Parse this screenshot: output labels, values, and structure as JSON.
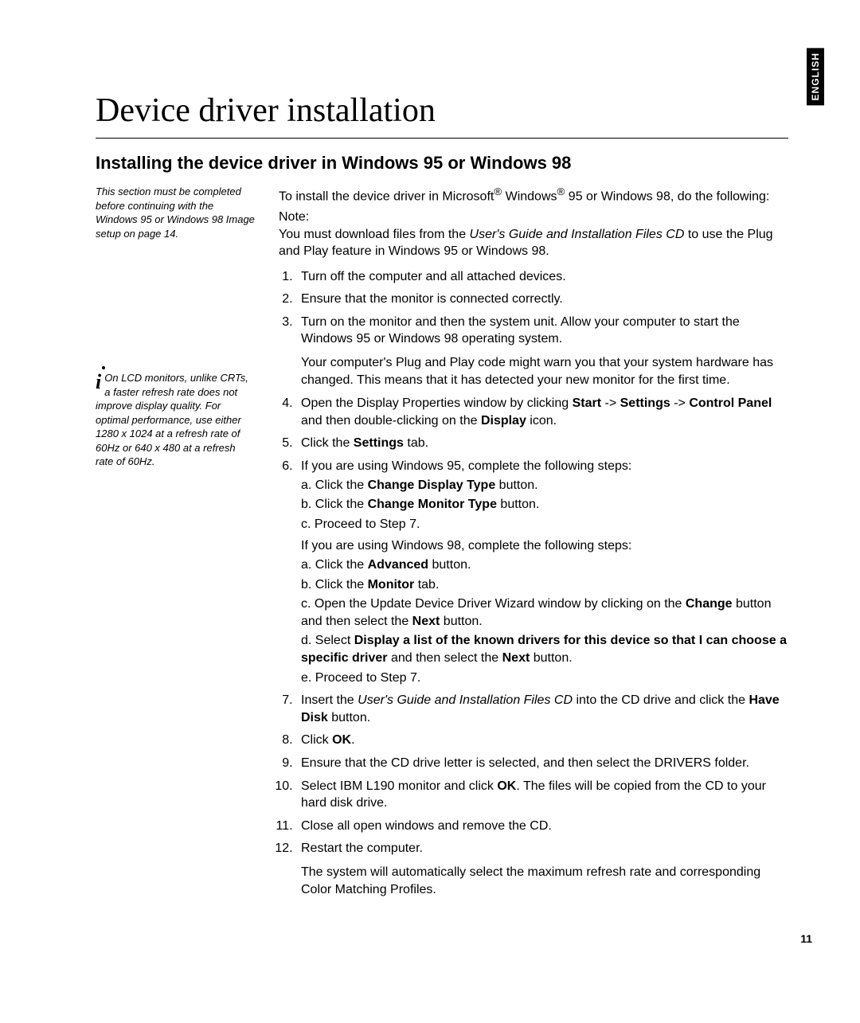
{
  "lang_tab": "ENGLISH",
  "main_title": "Device driver installation",
  "section_title": "Installing the device driver in Windows 95 or Windows 98",
  "sidebar": {
    "note1": "This section must be completed before continuing with the Windows 95 or Windows 98 Image setup on page 14.",
    "note2": "On LCD monitors, unlike CRTs, a faster refresh rate does not improve display quality. For optimal performance, use either 1280 x 1024 at a refresh rate of 60Hz or 640 x 480 at a refresh rate of 60Hz."
  },
  "content": {
    "intro_a": "To install the device driver in Microsoft",
    "reg": "®",
    "intro_b": " Windows",
    "intro_c": " 95 or Windows 98, do the following:",
    "note_label": "Note:",
    "note_body_a": "You must download files from the ",
    "note_body_it": "User's Guide and Installation Files CD",
    "note_body_b": " to use the Plug and Play feature in Windows 95 or Windows 98.",
    "step1": "Turn off the computer and all attached devices.",
    "step2": "Ensure that the monitor is connected correctly.",
    "step3": "Turn on the monitor and then the system unit. Allow your computer to start the Windows 95 or Windows 98 operating system.",
    "step3_p": "Your computer's Plug and Play code might warn you that your system hardware has changed. This means that it has detected your new monitor for the first time.",
    "step4_a": "Open the Display Properties window by clicking ",
    "step4_b": "Start",
    "step4_c": " -> ",
    "step4_d": "Settings",
    "step4_e": " -> ",
    "step4_f": "Control Panel",
    "step4_g": " and then double-clicking on the ",
    "step4_h": "Display",
    "step4_i": " icon.",
    "step5_a": "Click the ",
    "step5_b": "Settings",
    "step5_c": " tab.",
    "step6": "If you are using Windows 95, complete the following steps:",
    "s6a_a": "a. Click the ",
    "s6a_b": "Change Display Type",
    "s6a_c": " button.",
    "s6b_a": "b. Click the ",
    "s6b_b": "Change Monitor Type",
    "s6b_c": " button.",
    "s6c": "c. Proceed to Step 7.",
    "step6_98": "If you are using Windows 98, complete the following steps:",
    "s98a_a": "a. Click the ",
    "s98a_b": "Advanced",
    "s98a_c": " button.",
    "s98b_a": "b. Click the ",
    "s98b_b": "Monitor",
    "s98b_c": " tab.",
    "s98c_a": "c. Open the Update Device Driver Wizard window by clicking on the ",
    "s98c_b": "Change",
    "s98c_c": " button and then select the ",
    "s98c_d": "Next",
    "s98c_e": " button.",
    "s98d_a": "d. Select ",
    "s98d_b": "Display a list of the known drivers for this device so that I can choose a specific driver",
    "s98d_c": " and then select the ",
    "s98d_d": "Next",
    "s98d_e": " button.",
    "s98e": "e. Proceed to Step 7.",
    "step7_a": "Insert the ",
    "step7_it": "User's Guide and Installation Files CD",
    "step7_b": " into the CD drive and click the ",
    "step7_c": "Have Disk",
    "step7_d": " button.",
    "step8_a": "Click ",
    "step8_b": "OK",
    "step8_c": ".",
    "step9": "Ensure that the CD drive letter is selected, and then select the DRIVERS folder.",
    "step10_a": "Select IBM L190 monitor and click ",
    "step10_b": "OK",
    "step10_c": ". The files will be copied from the CD to your hard disk drive.",
    "step11": "Close all open windows and remove the CD.",
    "step12": "Restart the computer.",
    "step12_p": "The system will automatically select the maximum refresh rate and corresponding Color Matching Profiles."
  },
  "page_number": "11"
}
